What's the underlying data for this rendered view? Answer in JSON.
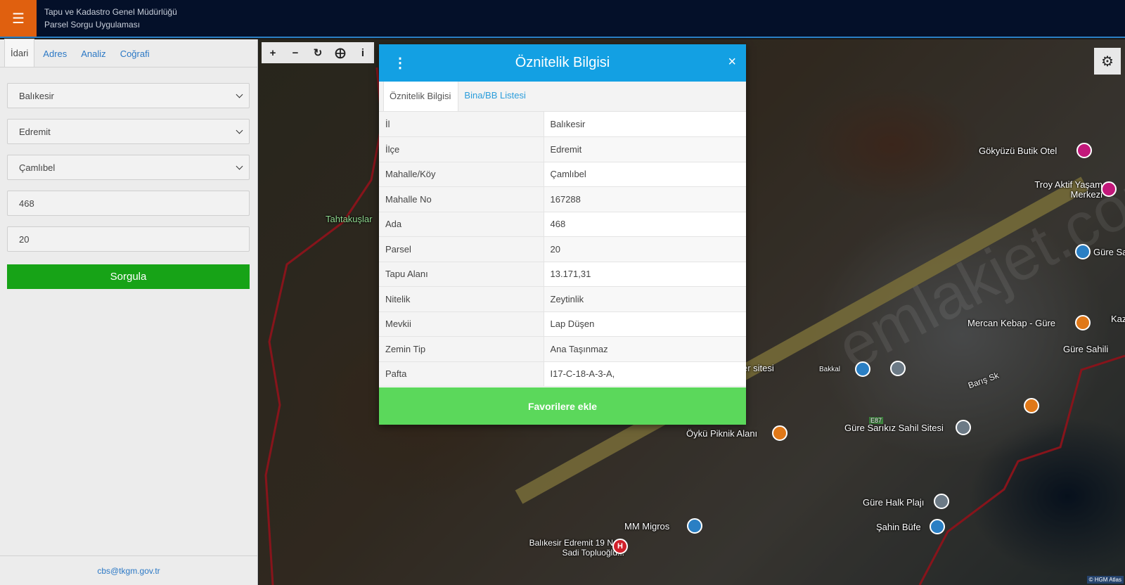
{
  "header": {
    "menu_icon": "hamburger-icon",
    "org_name": "Tapu ve Kadastro Genel Müdürlüğü",
    "app_name": "Parsel Sorgu Uygulaması"
  },
  "sidebar": {
    "tabs": [
      {
        "label": "İdari",
        "active": true
      },
      {
        "label": "Adres",
        "active": false
      },
      {
        "label": "Analiz",
        "active": false
      },
      {
        "label": "Coğrafi",
        "active": false
      }
    ],
    "fields": {
      "il": "Balıkesir",
      "ilce": "Edremit",
      "mahalle": "Çamlıbel",
      "ada": "468",
      "parsel": "20"
    },
    "query_label": "Sorgula",
    "footer_email": "cbs@tkgm.gov.tr"
  },
  "map": {
    "tools": [
      "plus-icon",
      "minus-icon",
      "refresh-icon",
      "locate-icon",
      "info-icon"
    ],
    "settings_icon": "gear-icon",
    "pois": {
      "tahtakuslar": "Tahtakuşlar",
      "gokyuzu": "Gökyüzü Butik Otel",
      "troy": "Troy Aktif Yaşam Merkezi",
      "gure_sal": "Güre Sal",
      "mercan": "Mercan Kebap - Güre",
      "kaz": "Kaz",
      "gure_sahili": "Güre Sahili",
      "er_sitesi": "er sitesi",
      "bakkal": "Bakkal",
      "baris": "Barış Sk",
      "road_no": "E87",
      "sarikiz": "Güre Sarıkız Sahil Sitesi",
      "oyku": "Öykü Piknik Alanı",
      "halk": "Güre Halk Plajı",
      "migros": "MM Migros",
      "sahin": "Şahin Büfe",
      "hospital": "Balıkesir Edremit 19 Nolu Sadi Topluoğlu..."
    },
    "watermark": "emlakjet.com",
    "attribution": "© HGM Atlas",
    "colors": {
      "boundary": "#d0202a",
      "road": "#b9a858"
    }
  },
  "modal": {
    "title": "Öznitelik Bilgisi",
    "menu_icon": "kebab-menu-icon",
    "close_icon": "close-icon",
    "tabs": [
      {
        "label": "Öznitelik Bilgisi",
        "active": true
      },
      {
        "label": "Bina/BB Listesi",
        "active": false
      }
    ],
    "rows": [
      {
        "key": "İl",
        "value": "Balıkesir"
      },
      {
        "key": "İlçe",
        "value": "Edremit"
      },
      {
        "key": "Mahalle/Köy",
        "value": "Çamlıbel"
      },
      {
        "key": "Mahalle No",
        "value": "167288"
      },
      {
        "key": "Ada",
        "value": "468"
      },
      {
        "key": "Parsel",
        "value": "20"
      },
      {
        "key": "Tapu Alanı",
        "value": "13.171,31"
      },
      {
        "key": "Nitelik",
        "value": "Zeytinlik"
      },
      {
        "key": "Mevkii",
        "value": "Lap Düşen"
      },
      {
        "key": "Zemin Tip",
        "value": "Ana Taşınmaz"
      },
      {
        "key": "Pafta",
        "value": "I17-C-18-A-3-A,"
      }
    ],
    "favorite_label": "Favorilere ekle",
    "colors": {
      "header": "#13a0e3",
      "favorite": "#5bd85b"
    }
  }
}
